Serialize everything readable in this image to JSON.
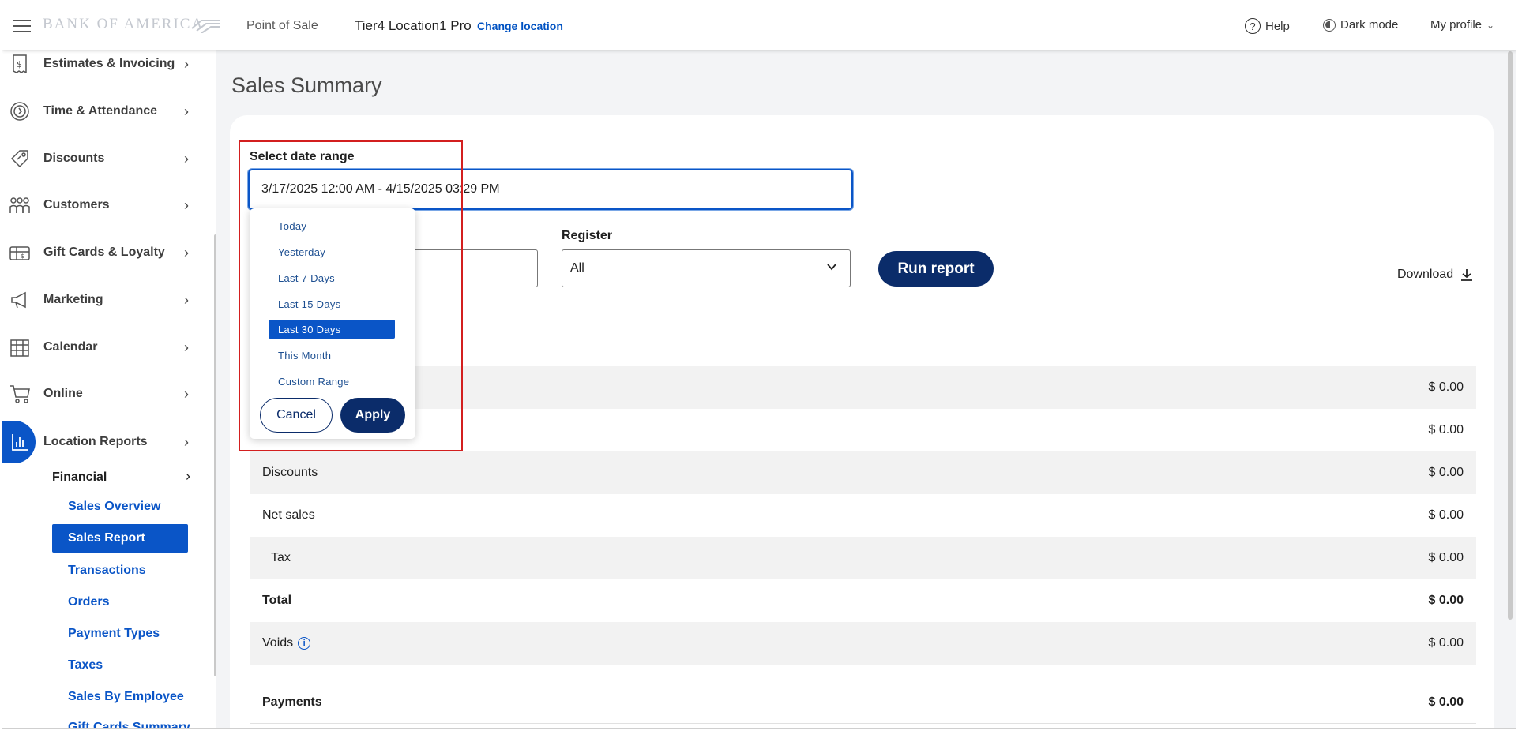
{
  "header": {
    "logo_text": "BANK OF AMERICA",
    "app_name": "Point of Sale",
    "location_name": "Tier4 Location1 Pro",
    "change_location": "Change location",
    "help": "Help",
    "dark_mode": "Dark mode",
    "my_profile": "My profile"
  },
  "sidebar": {
    "items": [
      {
        "label": "Estimates & Invoicing",
        "icon": "invoice-icon"
      },
      {
        "label": "Time & Attendance",
        "icon": "clock-icon"
      },
      {
        "label": "Discounts",
        "icon": "tag-icon"
      },
      {
        "label": "Customers",
        "icon": "people-icon"
      },
      {
        "label": "Gift Cards & Loyalty",
        "icon": "gift-card-icon"
      },
      {
        "label": "Marketing",
        "icon": "megaphone-icon"
      },
      {
        "label": "Calendar",
        "icon": "calendar-icon"
      },
      {
        "label": "Online",
        "icon": "cart-icon"
      },
      {
        "label": "Location Reports",
        "icon": "bar-chart-icon"
      }
    ],
    "financial": "Financial",
    "sub_items": [
      "Sales Overview",
      "Sales Report",
      "Transactions",
      "Orders",
      "Payment Types",
      "Taxes",
      "Sales By Employee",
      "Gift Cards Summary"
    ]
  },
  "main": {
    "page_title": "Sales Summary",
    "date_range_label": "Select date range",
    "date_range_value": "3/17/2025 12:00 AM - 4/15/2025 03:29 PM",
    "register_label": "Register",
    "register_value": "All",
    "run_report": "Run report",
    "download": "Download"
  },
  "dropdown": {
    "options": [
      "Today",
      "Yesterday",
      "Last 7 Days",
      "Last 15 Days",
      "Last 30 Days",
      "This Month",
      "Custom Range"
    ],
    "selected": "Last 30 Days",
    "cancel": "Cancel",
    "apply": "Apply"
  },
  "table": {
    "rows": [
      {
        "label": "",
        "value": "$ 0.00"
      },
      {
        "label": "",
        "value": "$ 0.00"
      },
      {
        "label": "Discounts",
        "value": "$ 0.00"
      },
      {
        "label": "Net sales",
        "value": "$ 0.00"
      },
      {
        "label": "Tax",
        "value": "$ 0.00"
      },
      {
        "label": "Total",
        "value": "$ 0.00"
      },
      {
        "label": "Voids",
        "value": "$ 0.00"
      },
      {
        "label": "Payments",
        "value": "$ 0.00"
      }
    ]
  },
  "colors": {
    "accent": "#0a55c7",
    "navy": "#0b2c6a",
    "annotation": "#d31f1f"
  }
}
